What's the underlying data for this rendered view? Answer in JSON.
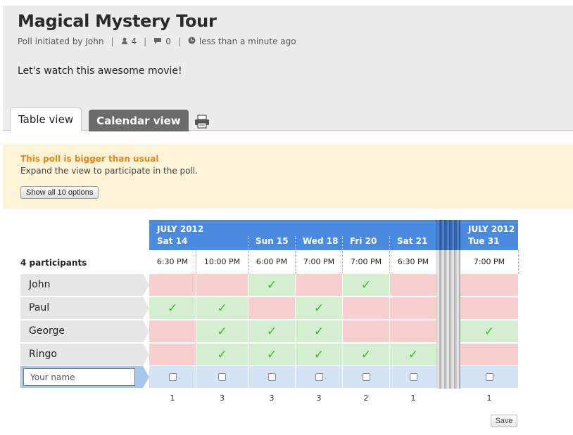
{
  "poll": {
    "title": "Magical Mystery Tour",
    "initiated_by": "Poll initiated by John",
    "participant_count": "4",
    "comment_count": "0",
    "time_ago": "less than a minute ago",
    "description": "Let's watch this awesome movie!"
  },
  "tabs": [
    {
      "label": "Table view",
      "active": true
    },
    {
      "label": "Calendar view",
      "active": false
    }
  ],
  "notice": {
    "title": "This poll is bigger than usual",
    "text": "Expand the view to participate in the poll.",
    "button": "Show all 10 options"
  },
  "table": {
    "month_label": "JULY 2012",
    "month_label_2": "JULY 2012",
    "participants_label": "4 participants",
    "dates": [
      {
        "day": "Sat 14",
        "time": "6:30 PM"
      },
      {
        "day": "",
        "time": "10:00 PM"
      },
      {
        "day": "Sun 15",
        "time": "6:00 PM"
      },
      {
        "day": "Wed 18",
        "time": "7:00 PM"
      },
      {
        "day": "Fri 20",
        "time": "7:00 PM"
      },
      {
        "day": "Sat 21",
        "time": "6:30 PM"
      },
      {
        "day": "Tue 31",
        "time": "7:00 PM"
      }
    ],
    "rows": [
      {
        "name": "John",
        "votes": [
          0,
          0,
          1,
          0,
          1,
          0,
          0
        ]
      },
      {
        "name": "Paul",
        "votes": [
          1,
          1,
          0,
          1,
          0,
          0,
          0
        ]
      },
      {
        "name": "George",
        "votes": [
          0,
          1,
          1,
          1,
          0,
          0,
          1
        ]
      },
      {
        "name": "Ringo",
        "votes": [
          0,
          1,
          1,
          1,
          1,
          1,
          0
        ]
      }
    ],
    "name_placeholder": "Your name",
    "counts": [
      "1",
      "3",
      "3",
      "3",
      "2",
      "1",
      "1"
    ],
    "save_label": "Save"
  },
  "colors": {
    "header_blue": "#4a8be0",
    "yes": "#d3efcf",
    "no": "#f8cfcf",
    "notice_orange": "#e8861b"
  }
}
